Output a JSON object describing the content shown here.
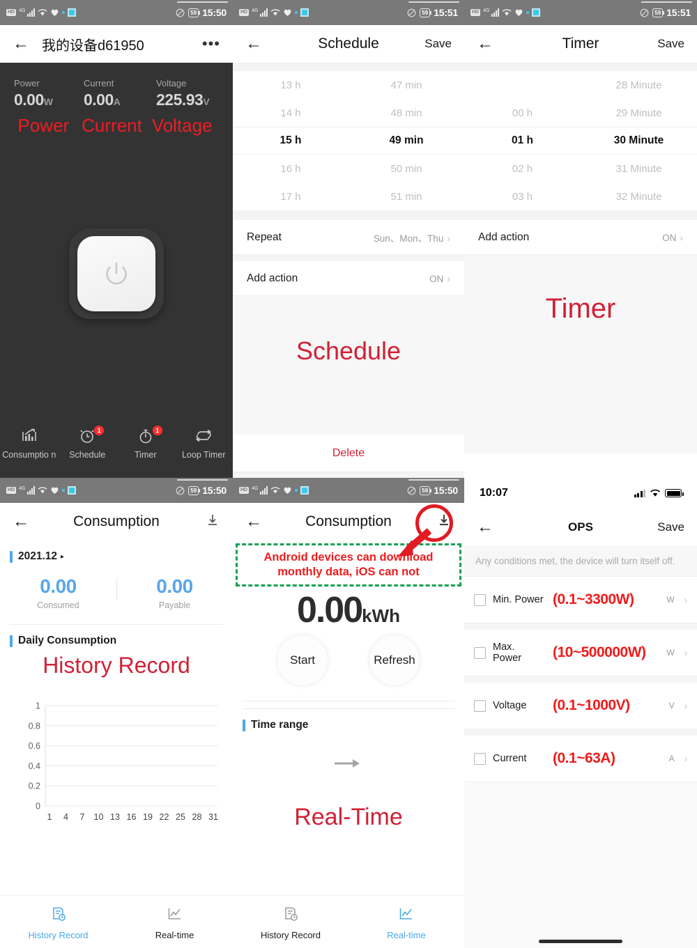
{
  "colors": {
    "red": "#ee1c1c",
    "crimson": "#cf2136",
    "blue": "#4aa8e8",
    "green_dash": "#17a055",
    "dark_bg": "#333333"
  },
  "status_bar_android": {
    "hd": "HD",
    "network": "4G",
    "time_1550": "15:50",
    "time_1551": "15:51",
    "battery": "59"
  },
  "status_bar_ios": {
    "time": "10:07"
  },
  "panel_device": {
    "title": "我的设备d61950",
    "more_label": "•••",
    "metrics": [
      {
        "label": "Power",
        "value": "0.00",
        "unit": "W"
      },
      {
        "label": "Current",
        "value": "0.00",
        "unit": "A"
      },
      {
        "label": "Voltage",
        "value": "225.93",
        "unit": "V"
      }
    ],
    "annotations": [
      "Power",
      "Current",
      "Voltage"
    ],
    "bottom_nav": [
      {
        "label": "Consumptio n",
        "icon": "consumption-chart-icon",
        "badge": ""
      },
      {
        "label": "Schedule",
        "icon": "alarm-clock-icon",
        "badge": "1"
      },
      {
        "label": "Timer",
        "icon": "stopwatch-icon",
        "badge": "1"
      },
      {
        "label": "Loop Timer",
        "icon": "loop-repeat-icon",
        "badge": ""
      }
    ]
  },
  "panel_schedule": {
    "title": "Schedule",
    "save_label": "Save",
    "hours": [
      "13 h",
      "14 h",
      "15 h",
      "16 h",
      "17 h"
    ],
    "minutes": [
      "47 min",
      "48 min",
      "49 min",
      "50 min",
      "51 min"
    ],
    "selected_index": 2,
    "repeat_label": "Repeat",
    "repeat_value": "Sun、Mon、Thu",
    "add_action_label": "Add action",
    "add_action_value": "ON",
    "overlay_text": "Schedule",
    "delete_label": "Delete"
  },
  "panel_timer": {
    "title": "Timer",
    "save_label": "Save",
    "hours": [
      "",
      "00 h",
      "01 h",
      "02 h",
      "03 h"
    ],
    "minutes": [
      "28 Minute",
      "29 Minute",
      "30 Minute",
      "31 Minute",
      "32 Minute"
    ],
    "selected_index": 2,
    "add_action_label": "Add action",
    "add_action_value": "ON",
    "overlay_text": "Timer"
  },
  "panel_consumption": {
    "title": "Consumption",
    "download_icon": "download-icon",
    "month": "2021.12",
    "totals": [
      {
        "value": "0.00",
        "label": "Consumed"
      },
      {
        "value": "0.00",
        "label": "Payable"
      }
    ],
    "daily_title": "Daily Consumption",
    "overlay_text": "History Record",
    "tabs": [
      {
        "label": "History Record",
        "active": true
      },
      {
        "label": "Real-time",
        "active": false
      }
    ]
  },
  "chart_data": {
    "type": "line",
    "title": "Daily Consumption",
    "x": [
      1,
      4,
      7,
      10,
      13,
      16,
      19,
      22,
      25,
      28,
      31
    ],
    "xtick_labels": [
      "1",
      "4",
      "7",
      "10",
      "13",
      "16",
      "19",
      "22",
      "25",
      "28",
      "31"
    ],
    "ytick_labels": [
      "0",
      "0.2",
      "0.4",
      "0.6",
      "0.8",
      "1"
    ],
    "values": [],
    "ylim": [
      0,
      1
    ],
    "xlabel": "",
    "ylabel": "",
    "grid": true,
    "legend": "none"
  },
  "panel_realtime": {
    "title": "Consumption",
    "download_icon": "download-icon",
    "annotation_line1": "Android devices can download",
    "annotation_line2": "monthly data, iOS  can not",
    "reading_value": "0.00",
    "reading_unit": "kWh",
    "start_label": "Start",
    "refresh_label": "Refresh",
    "time_range_label": "Time range",
    "overlay_text": "Real-Time",
    "tabs": [
      {
        "label": "History Record",
        "active": false
      },
      {
        "label": "Real-time",
        "active": true
      }
    ]
  },
  "panel_ops": {
    "title": "OPS",
    "save_label": "Save",
    "note": "Any conditions met, the device will turn itself off.",
    "rows": [
      {
        "label": "Min. Power",
        "range": "(0.1~3300W)",
        "unit": "W"
      },
      {
        "label": "Max. Power",
        "range": "(10~500000W)",
        "unit": "W"
      },
      {
        "label": "Voltage",
        "range": "(0.1~1000V)",
        "unit": "V"
      },
      {
        "label": "Current",
        "range": "(0.1~63A)",
        "unit": "A"
      }
    ]
  }
}
